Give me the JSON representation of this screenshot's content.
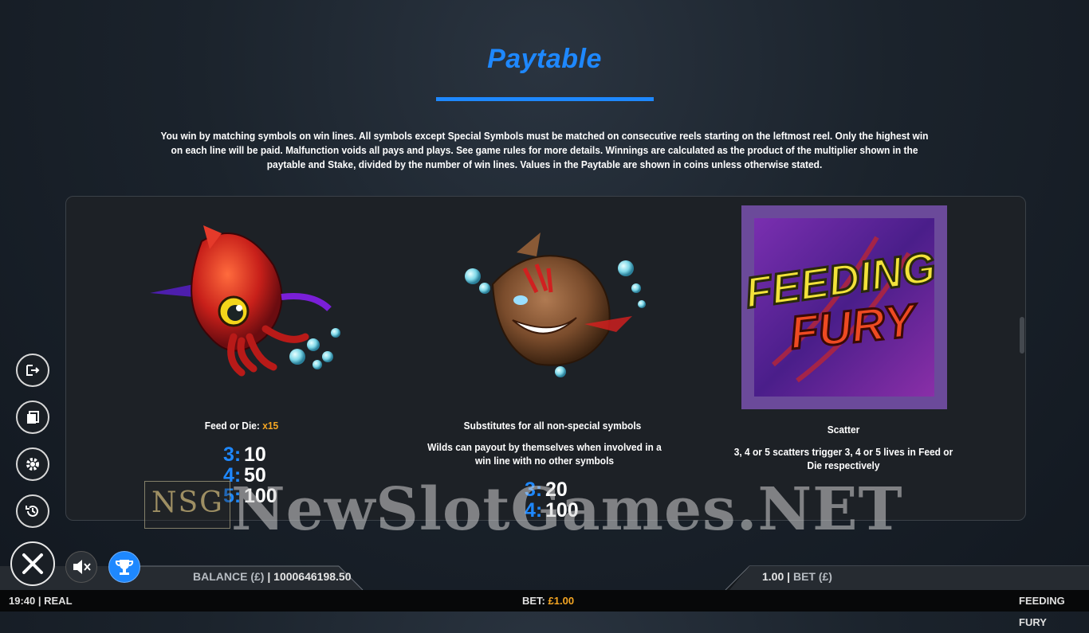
{
  "title": "Paytable",
  "intro": "You win by matching symbols on win lines. All symbols except Special Symbols must be matched on consecutive reels starting on the leftmost reel. Only the highest win on each line will be paid. Malfunction voids all pays and plays. See game rules for more details. Winnings are calculated as the product of the multiplier shown in the paytable and Stake, divided by the number of win lines. Values in the Paytable are shown in coins unless otherwise stated.",
  "symbols": {
    "feed_or_die": {
      "label": "Feed or Die: ",
      "multiplier": "x15",
      "pays": [
        {
          "count": "3:",
          "value": "10"
        },
        {
          "count": "4:",
          "value": "50"
        },
        {
          "count": "5:",
          "value": "100"
        }
      ]
    },
    "wild": {
      "line1": "Substitutes for all non-special symbols",
      "line2": "Wilds can payout by themselves when involved in a win line with no other symbols",
      "pays": [
        {
          "count": "3:",
          "value": "20"
        },
        {
          "count": "4:",
          "value": "100"
        }
      ]
    },
    "scatter": {
      "logo_line1": "FEEDING",
      "logo_line2": "FURY",
      "label": "Scatter",
      "description": "3, 4 or 5 scatters trigger 3, 4 or 5 lives in Feed or Die respectively"
    }
  },
  "side_buttons": [
    "exit-icon",
    "rules-icon",
    "settings-icon",
    "history-icon"
  ],
  "bottom": {
    "balance_label": "BALANCE (£)",
    "balance_value": "1000646198.50",
    "bet_value": "1.00",
    "bet_label": "BET  (£)"
  },
  "status": {
    "time": "19:40",
    "mode": "REAL",
    "bet_label": "BET:",
    "bet_value": "£1.00",
    "game_name": "FEEDING FURY"
  },
  "watermark": {
    "logo": "NSG",
    "text": "NewSlotGames.NET"
  },
  "colors": {
    "accent": "#1e88ff",
    "highlight": "#f5a623",
    "background": "#1b232c"
  }
}
